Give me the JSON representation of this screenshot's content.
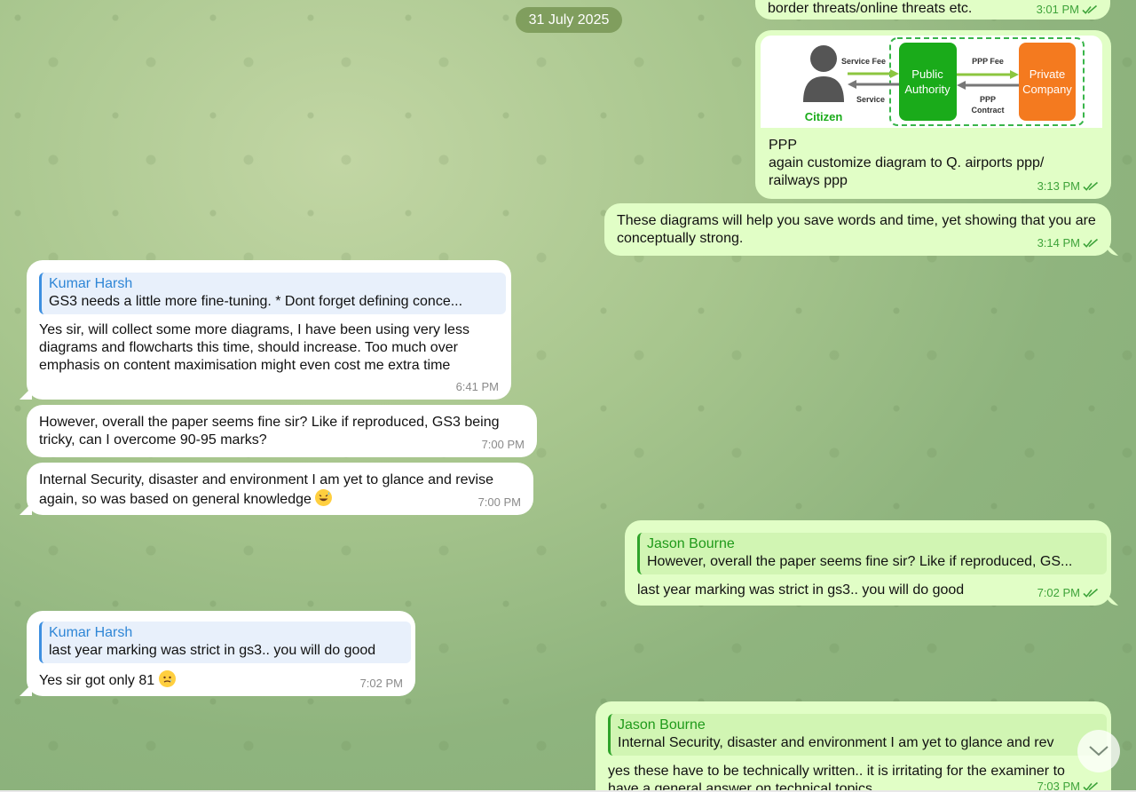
{
  "date_separator": "31 July 2025",
  "colors": {
    "outgoing_bubble": "#e1fec6",
    "incoming_bubble": "#ffffff",
    "read_checks": "#3ea33a",
    "reply_name_in": "#2f86d6",
    "reply_name_out": "#1f9a1a"
  },
  "messages": [
    {
      "direction": "out",
      "text": "border threats/online threats etc.",
      "time": "3:01 PM",
      "status": "read"
    },
    {
      "direction": "out",
      "image": {
        "citizen": "Citizen",
        "public_authority_line1": "Public",
        "public_authority_line2": "Authority",
        "private_company_line1": "Private",
        "private_company_line2": "Company",
        "service_fee": "Service Fee",
        "service": "Service",
        "ppp_fee": "PPP Fee",
        "ppp_contract_line1": "PPP",
        "ppp_contract_line2": "Contract"
      },
      "text_line1": "PPP",
      "text_line2": "again customize diagram to Q. airports ppp/",
      "text_line3": "railways ppp",
      "time": "3:13 PM",
      "status": "read"
    },
    {
      "direction": "out",
      "text": "These diagrams will help you save words and time, yet showing that you are conceptually strong.",
      "time": "3:14 PM",
      "status": "read"
    },
    {
      "direction": "in",
      "reply": {
        "name": "Kumar Harsh",
        "text": "GS3 needs a little more fine-tuning. * Dont forget defining conce..."
      },
      "text": "Yes sir, will collect some more diagrams, I have been using very less diagrams and flowcharts this time, should increase. Too much over emphasis on content maximisation might even cost me extra time",
      "time": "6:41 PM"
    },
    {
      "direction": "in",
      "text": "However, overall the paper seems fine sir? Like if reproduced, GS3 being tricky, can I overcome 90-95 marks?",
      "time": "7:00 PM"
    },
    {
      "direction": "in",
      "text": "Internal Security, disaster and environment I am yet to glance and revise again, so was based on general knowledge",
      "emoji": "grinning-sweat-emoji",
      "time": "7:00 PM"
    },
    {
      "direction": "out",
      "reply": {
        "name": "Jason Bourne",
        "text": "However, overall the paper seems fine sir? Like if reproduced, GS..."
      },
      "text": "last year marking was strict in gs3.. you will do good",
      "time": "7:02 PM",
      "status": "read"
    },
    {
      "direction": "in",
      "reply": {
        "name": "Kumar Harsh",
        "text": "last year marking was strict in gs3.. you will do good"
      },
      "text": "Yes sir got only 81",
      "emoji": "tearful-smile-emoji",
      "time": "7:02 PM"
    },
    {
      "direction": "out",
      "reply": {
        "name": "Jason Bourne",
        "text": "Internal Security, disaster and environment I am yet to glance and rev"
      },
      "text": "yes these have to be technically written.. it is irritating for the examiner to have a general answer on technical topics",
      "time": "7:03 PM",
      "status": "read"
    }
  ],
  "scroll_button_icon": "chevron-down-icon"
}
